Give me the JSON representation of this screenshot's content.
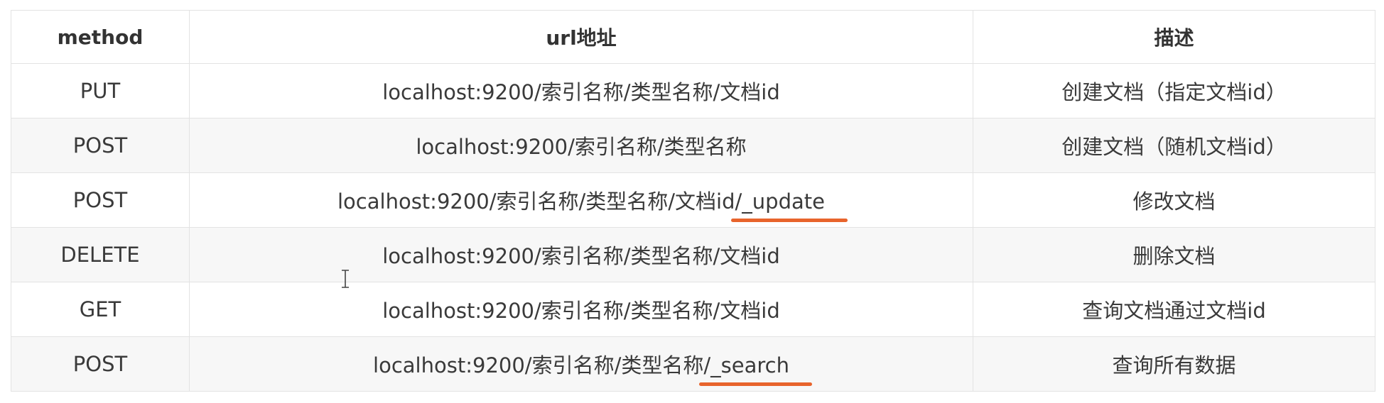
{
  "table": {
    "headers": {
      "method": "method",
      "url": "url地址",
      "desc": "描述"
    },
    "rows": [
      {
        "method": "PUT",
        "url": "localhost:9200/索引名称/类型名称/文档id",
        "url_highlight": "",
        "desc": "创建文档（指定文档id）"
      },
      {
        "method": "POST",
        "url": "localhost:9200/索引名称/类型名称",
        "url_highlight": "",
        "desc": "创建文档（随机文档id）"
      },
      {
        "method": "POST",
        "url": "localhost:9200/索引名称/类型名称/文档id",
        "url_highlight": "/_update",
        "desc": "修改文档"
      },
      {
        "method": "DELETE",
        "url": "localhost:9200/索引名称/类型名称/文档id",
        "url_highlight": "",
        "desc": "删除文档"
      },
      {
        "method": "GET",
        "url": "localhost:9200/索引名称/类型名称/文档id",
        "url_highlight": "",
        "desc": "查询文档通过文档id"
      },
      {
        "method": "POST",
        "url": "localhost:9200/索引名称/类型名称",
        "url_highlight": "/_search",
        "desc": "查询所有数据"
      }
    ]
  },
  "colors": {
    "underline": "#e8642c",
    "border": "#e3e3e3",
    "row_alt": "#f7f7f7",
    "text": "#333333"
  },
  "icons": {
    "cursor": "text-cursor-icon"
  }
}
